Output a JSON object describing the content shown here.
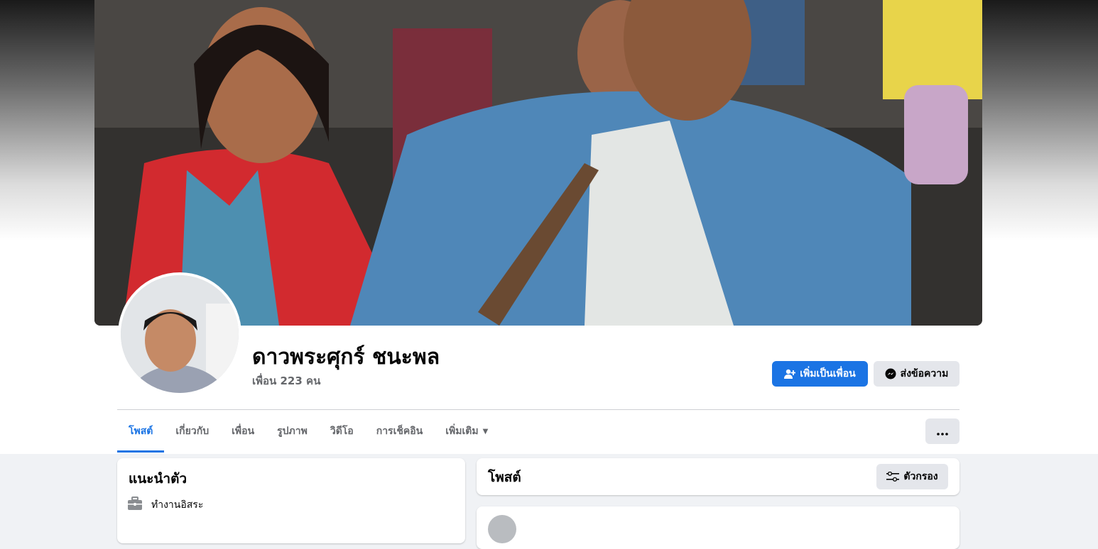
{
  "profile": {
    "name": "ดาวพระศุกร์ ชนะพล",
    "friends": "เพื่อน 223 คน"
  },
  "actions": {
    "add_friend": "เพิ่มเป็นเพื่อน",
    "message": "ส่งข้อความ"
  },
  "tabs": [
    {
      "label": "โพสต์",
      "active": true
    },
    {
      "label": "เกี่ยวกับ"
    },
    {
      "label": "เพื่อน"
    },
    {
      "label": "รูปภาพ"
    },
    {
      "label": "วิดีโอ"
    },
    {
      "label": "การเช็คอิน"
    },
    {
      "label": "เพิ่มเติม"
    }
  ],
  "intro": {
    "title": "แนะนำตัว",
    "work": "ทำงานอิสระ"
  },
  "posts": {
    "title": "โพสต์",
    "filter": "ตัวกรอง"
  },
  "colors": {
    "primary": "#1b74e4",
    "background": "#f0f2f5",
    "secondary_button": "#e4e6eb"
  }
}
